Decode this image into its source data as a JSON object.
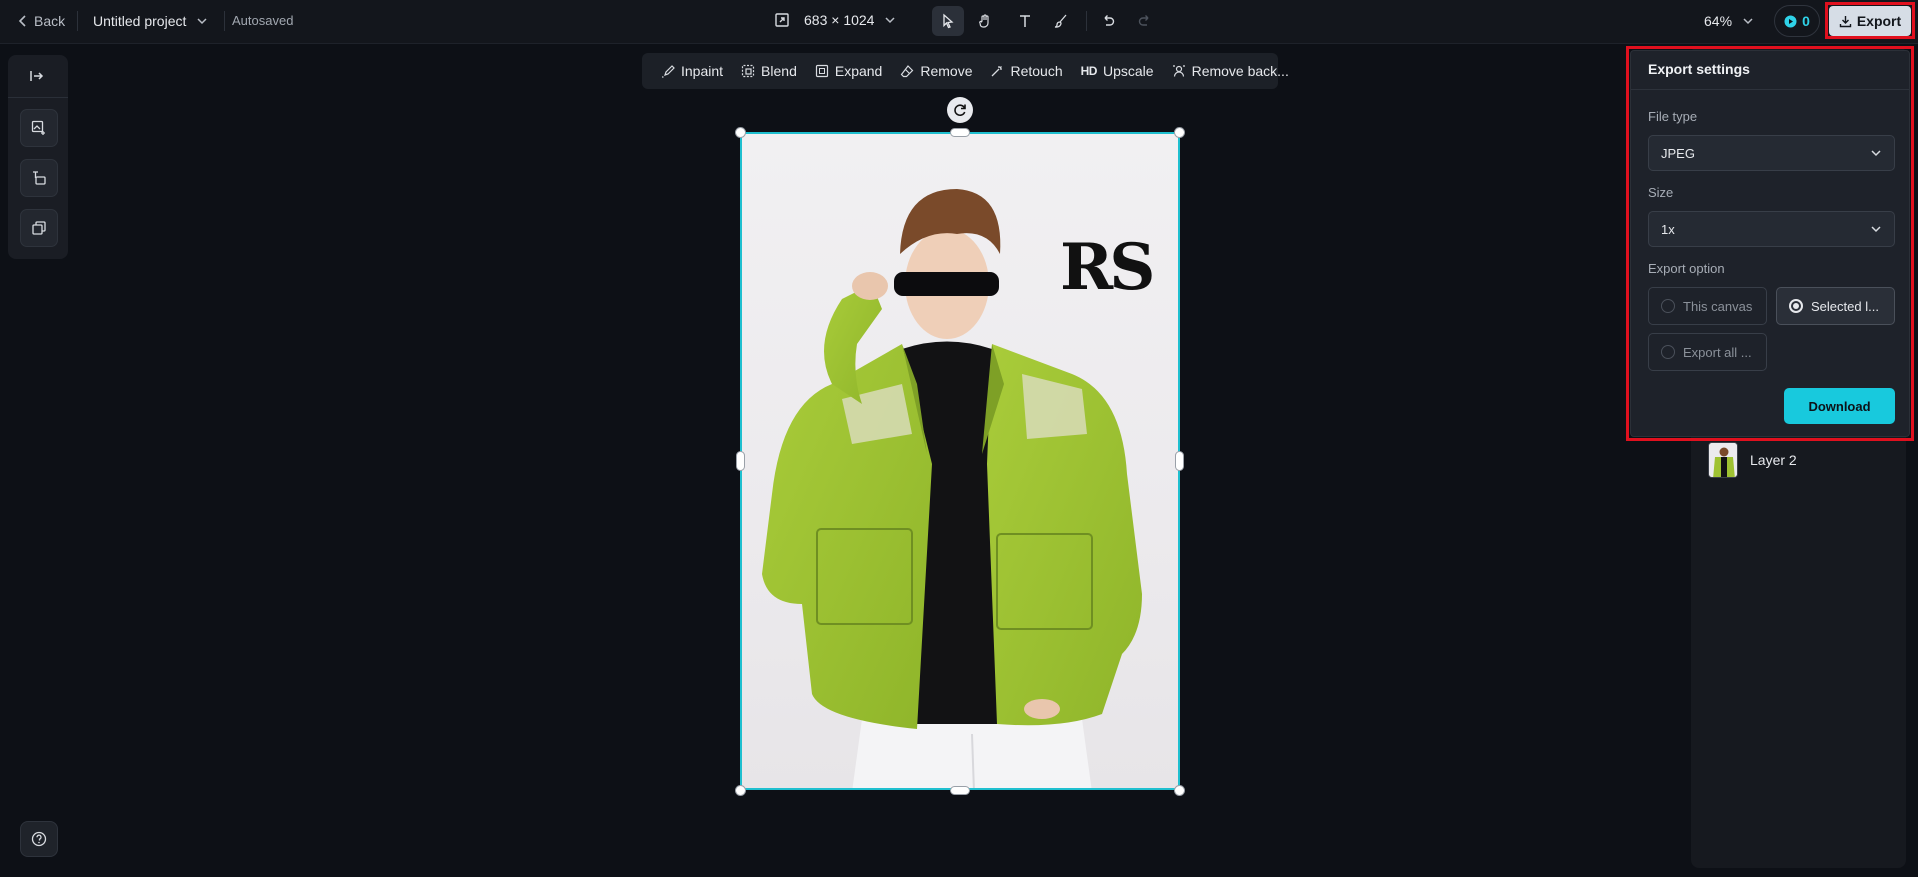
{
  "header": {
    "back_label": "Back",
    "project_name": "Untitled project",
    "save_status": "Autosaved",
    "canvas_size": "683 × 1024",
    "zoom": "64%",
    "credits": "0",
    "export_label": "Export"
  },
  "edit_toolbar": {
    "items": [
      "Inpaint",
      "Blend",
      "Expand",
      "Remove",
      "Retouch",
      "Upscale",
      "Remove back..."
    ],
    "upscale_badge": "HD"
  },
  "canvas": {
    "logo_text": "RS"
  },
  "layers": {
    "items": [
      {
        "label": "Layer 2"
      }
    ]
  },
  "export_panel": {
    "title": "Export settings",
    "file_type_label": "File type",
    "file_type_value": "JPEG",
    "size_label": "Size",
    "size_value": "1x",
    "export_option_label": "Export option",
    "options": [
      "This canvas",
      "Selected l...",
      "Export all ..."
    ],
    "selected_option": "Selected l...",
    "download_label": "Download"
  },
  "colors": {
    "accent": "#18c9dd",
    "highlight": "#e0101e",
    "background": "#0d1016"
  }
}
